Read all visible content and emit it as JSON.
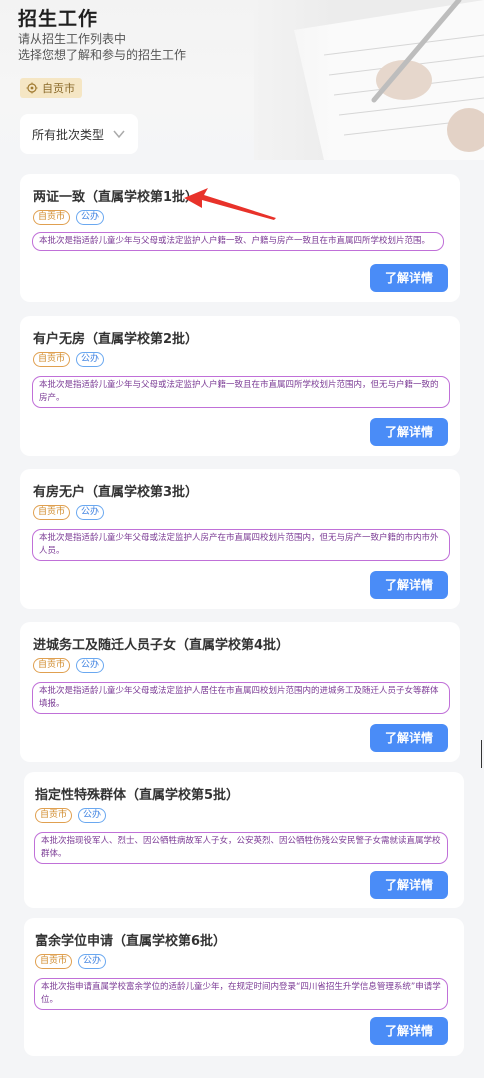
{
  "header": {
    "title": "招生工作",
    "subtitle_line1": "请从招生工作列表中",
    "subtitle_line2": "选择您想了解和参与的招生工作",
    "location": "自贡市"
  },
  "filter": {
    "label": "所有批次类型"
  },
  "colors": {
    "button": "#4a8cf7",
    "desc_border": "#c070d8",
    "tag_orange": "#e0a050",
    "tag_blue": "#6aa8f0",
    "arrow": "#e8322a"
  },
  "icons": {
    "location": "location-pin-icon",
    "filter": "chevron-down-icon"
  },
  "cards": [
    {
      "title": "两证一致（直属学校第1批）",
      "tags": [
        "自贡市",
        "公办"
      ],
      "desc": "本批次是指适龄儿童少年与父母或法定监护人户籍一致、户籍与房产一致且在市直属四所学校划片范围。",
      "button": "了解详情"
    },
    {
      "title": "有户无房（直属学校第2批）",
      "tags": [
        "自贡市",
        "公办"
      ],
      "desc": "本批次是指适龄儿童少年与父母或法定监护人户籍一致且在市直属四所学校划片范围内，但无与户籍一致的房产。",
      "button": "了解详情"
    },
    {
      "title": "有房无户（直属学校第3批）",
      "tags": [
        "自贡市",
        "公办"
      ],
      "desc": "本批次是指适龄儿童少年父母或法定监护人房产在市直属四校划片范围内，但无与房产一致户籍的市内市外人员。",
      "button": "了解详情"
    },
    {
      "title": "进城务工及随迁人员子女（直属学校第4批）",
      "tags": [
        "自贡市",
        "公办"
      ],
      "desc": "本批次是指适龄儿童少年父母或法定监护人居住在市直属四校划片范围内的进城务工及随迁人员子女等群体填报。",
      "button": "了解详情"
    },
    {
      "title": "指定性特殊群体（直属学校第5批）",
      "tags": [
        "自贡市",
        "公办"
      ],
      "desc": "本批次指现役军人、烈士、因公牺牲病故军人子女，公安英烈、因公牺牲伤残公安民警子女需就读直属学校群体。",
      "button": "了解详情"
    },
    {
      "title": "富余学位申请（直属学校第6批）",
      "tags": [
        "自贡市",
        "公办"
      ],
      "desc": "本批次指申请直属学校富余学位的适龄儿童少年，在规定时间内登录“四川省招生升学信息管理系统”申请学位。",
      "button": "了解详情"
    }
  ]
}
